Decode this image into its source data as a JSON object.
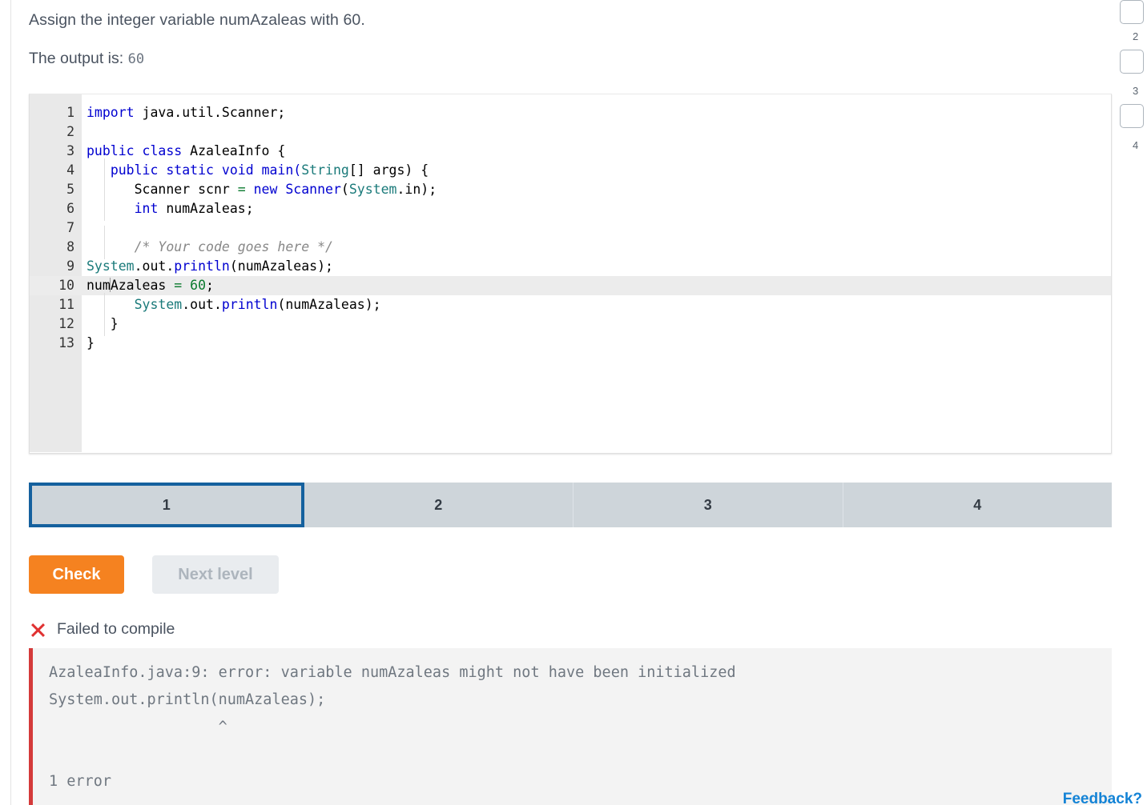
{
  "task": {
    "prompt": "Assign the integer variable numAzaleas with 60.",
    "output_label": "The output is:",
    "output_value": "60"
  },
  "editor": {
    "lines": [
      {
        "num": "1",
        "active": false,
        "guide": false,
        "tokens": [
          {
            "t": "import ",
            "c": "k"
          },
          {
            "t": "java.util.Scanner;",
            "c": ""
          }
        ]
      },
      {
        "num": "2",
        "active": false,
        "guide": false,
        "tokens": []
      },
      {
        "num": "3",
        "active": false,
        "guide": false,
        "tokens": [
          {
            "t": "public class ",
            "c": "k"
          },
          {
            "t": "AzaleaInfo {",
            "c": ""
          }
        ]
      },
      {
        "num": "4",
        "active": false,
        "guide": true,
        "tokens": [
          {
            "t": "   ",
            "c": ""
          },
          {
            "t": "public static void ",
            "c": "k"
          },
          {
            "t": "main(",
            "c": "m"
          },
          {
            "t": "String",
            "c": "t"
          },
          {
            "t": "[] args) {",
            "c": ""
          }
        ]
      },
      {
        "num": "5",
        "active": false,
        "guide": true,
        "tokens": [
          {
            "t": "      Scanner scnr ",
            "c": ""
          },
          {
            "t": "=",
            "c": "op"
          },
          {
            "t": " ",
            "c": ""
          },
          {
            "t": "new ",
            "c": "k"
          },
          {
            "t": "Scanner",
            "c": "m"
          },
          {
            "t": "(",
            "c": ""
          },
          {
            "t": "System",
            "c": "t"
          },
          {
            "t": ".in);",
            "c": ""
          }
        ]
      },
      {
        "num": "6",
        "active": false,
        "guide": true,
        "tokens": [
          {
            "t": "      ",
            "c": ""
          },
          {
            "t": "int",
            "c": "k"
          },
          {
            "t": " numAzaleas;",
            "c": ""
          }
        ]
      },
      {
        "num": "7",
        "active": false,
        "guide": true,
        "tokens": []
      },
      {
        "num": "8",
        "active": false,
        "guide": true,
        "tokens": [
          {
            "t": "      ",
            "c": ""
          },
          {
            "t": "/* Your code goes here */",
            "c": "cm"
          }
        ]
      },
      {
        "num": "9",
        "active": false,
        "guide": false,
        "tokens": [
          {
            "t": "System",
            "c": "t"
          },
          {
            "t": ".out.",
            "c": ""
          },
          {
            "t": "println",
            "c": "m"
          },
          {
            "t": "(numAzaleas);",
            "c": ""
          }
        ]
      },
      {
        "num": "10",
        "active": true,
        "guide": false,
        "tokens": [
          {
            "t": "num",
            "c": ""
          },
          {
            "t": "|CARET|",
            "c": "caret"
          },
          {
            "t": "Azaleas ",
            "c": ""
          },
          {
            "t": "=",
            "c": "op"
          },
          {
            "t": " ",
            "c": ""
          },
          {
            "t": "60",
            "c": "n"
          },
          {
            "t": ";",
            "c": ""
          }
        ]
      },
      {
        "num": "11",
        "active": false,
        "guide": true,
        "tokens": [
          {
            "t": "      ",
            "c": ""
          },
          {
            "t": "System",
            "c": "t"
          },
          {
            "t": ".out.",
            "c": ""
          },
          {
            "t": "println",
            "c": "m"
          },
          {
            "t": "(numAzaleas);",
            "c": ""
          }
        ]
      },
      {
        "num": "12",
        "active": false,
        "guide": true,
        "tokens": [
          {
            "t": "   }",
            "c": ""
          }
        ]
      },
      {
        "num": "13",
        "active": false,
        "guide": false,
        "tokens": [
          {
            "t": "}",
            "c": ""
          }
        ]
      }
    ]
  },
  "levels": {
    "tabs": [
      {
        "label": "1",
        "active": true
      },
      {
        "label": "2",
        "active": false
      },
      {
        "label": "3",
        "active": false
      },
      {
        "label": "4",
        "active": false
      }
    ]
  },
  "actions": {
    "check_label": "Check",
    "next_level_label": "Next level",
    "check_color": "#f58220"
  },
  "result": {
    "status_icon": "x-icon",
    "status_text": "Failed to compile",
    "status_color": "#e03131",
    "error_lines": [
      "AzaleaInfo.java:9: error: variable numAzaleas might not have been initialized",
      "System.out.println(numAzaleas);",
      "                   ^",
      "",
      "1 error"
    ]
  },
  "right_rail": {
    "items": [
      {
        "num": "2"
      },
      {
        "num": "3"
      },
      {
        "num": "4"
      }
    ]
  },
  "footer": {
    "feedback_label": "Feedback?"
  }
}
